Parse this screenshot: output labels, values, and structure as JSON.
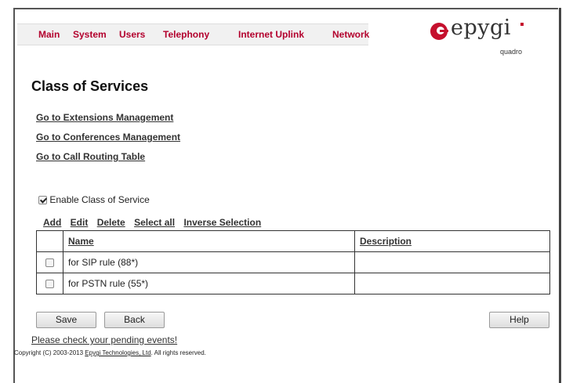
{
  "nav": {
    "items": [
      "Main",
      "System",
      "Users",
      "Telephony",
      "Internet Uplink",
      "Network"
    ]
  },
  "logo": {
    "brand": "epygi",
    "model": "quadro",
    "accent_color": "#c5102d"
  },
  "page": {
    "title": "Class of Services"
  },
  "links": {
    "extensions": "Go to Extensions Management",
    "conferences": "Go to Conferences Management",
    "routing": "Go to Call Routing Table"
  },
  "enable_cos": {
    "label": "Enable Class of Service",
    "checked": true
  },
  "toolbar": {
    "add": "Add",
    "edit": "Edit",
    "delete": "Delete",
    "select_all": "Select all",
    "inverse": "Inverse Selection"
  },
  "table": {
    "columns": [
      "Name",
      "Description"
    ],
    "rows": [
      {
        "name": "for SIP rule (88*)",
        "description": "",
        "checked": false
      },
      {
        "name": "for PSTN rule (55*)",
        "description": "",
        "checked": false
      }
    ]
  },
  "buttons": {
    "save": "Save",
    "back": "Back",
    "help": "Help"
  },
  "footer": {
    "pending": "Please check your pending events!",
    "copyright_prefix": "Copyright (C) 2003-2013 ",
    "company": "Epygi Technologies, Ltd",
    "copyright_suffix": ". All rights reserved."
  }
}
